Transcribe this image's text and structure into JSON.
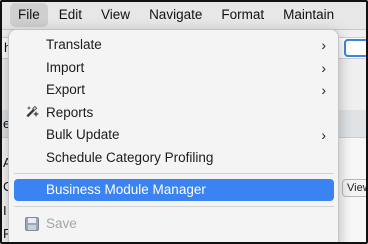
{
  "menubar": {
    "items": [
      "File",
      "Edit",
      "View",
      "Navigate",
      "Format",
      "Maintain"
    ],
    "active": "File"
  },
  "background": {
    "field_char": "h",
    "band_char": "e",
    "left_chars": [
      "A",
      "C",
      "I",
      "P"
    ],
    "view_button": "View"
  },
  "file_menu": {
    "items": [
      {
        "label": "Translate",
        "submenu": true
      },
      {
        "label": "Import",
        "submenu": true
      },
      {
        "label": "Export",
        "submenu": true
      },
      {
        "label": "Reports",
        "submenu": false,
        "icon": "reports-wand-icon"
      },
      {
        "label": "Bulk Update",
        "submenu": true
      },
      {
        "label": "Schedule Category Profiling",
        "submenu": false
      },
      {
        "label": "Business Module Manager",
        "submenu": false,
        "highlighted": true
      },
      {
        "label": "Save",
        "submenu": false,
        "disabled": true,
        "icon": "save-disk-icon"
      }
    ],
    "submenu_glyph": "›",
    "highlight_color": "#3b82f2"
  }
}
